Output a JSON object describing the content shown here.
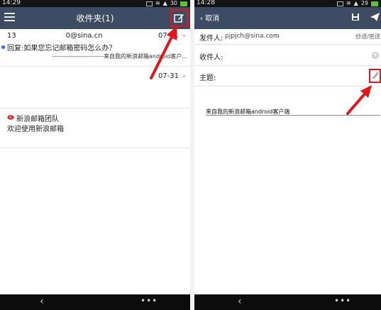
{
  "left_screen": {
    "status": {
      "time": "14:29",
      "signal": "30"
    },
    "header": {
      "title": "收件夹(1)"
    },
    "mails": [
      {
        "sender": "13       0@sina.cn",
        "date": "07-31",
        "subject": "回复:如果您忘记邮箱密码怎么办？",
        "preview": "-------------------------来自我的新浪邮箱android客户..."
      },
      {
        "date": "07-31"
      },
      {
        "sender": "新浪邮箱团队",
        "subject": "欢迎使用新浪邮箱"
      }
    ],
    "navbar": {
      "back": "‹",
      "menu": "•••"
    }
  },
  "right_screen": {
    "status": {
      "time": "14:28",
      "signal": "29"
    },
    "header": {
      "cancel": "取消"
    },
    "fields": {
      "from_label": "发件人:",
      "from_value": "pjpjch@sina.com",
      "cc_bcc": "抄送/密送",
      "to_label": "收件人:",
      "subject_label": "主题:"
    },
    "signature": "来自我的新浪邮箱android客户端",
    "navbar": {
      "back": "‹",
      "menu": "•••"
    }
  },
  "colors": {
    "header": "#3d4b63",
    "highlight": "#e0161b",
    "unread": "#2a6fd6"
  }
}
